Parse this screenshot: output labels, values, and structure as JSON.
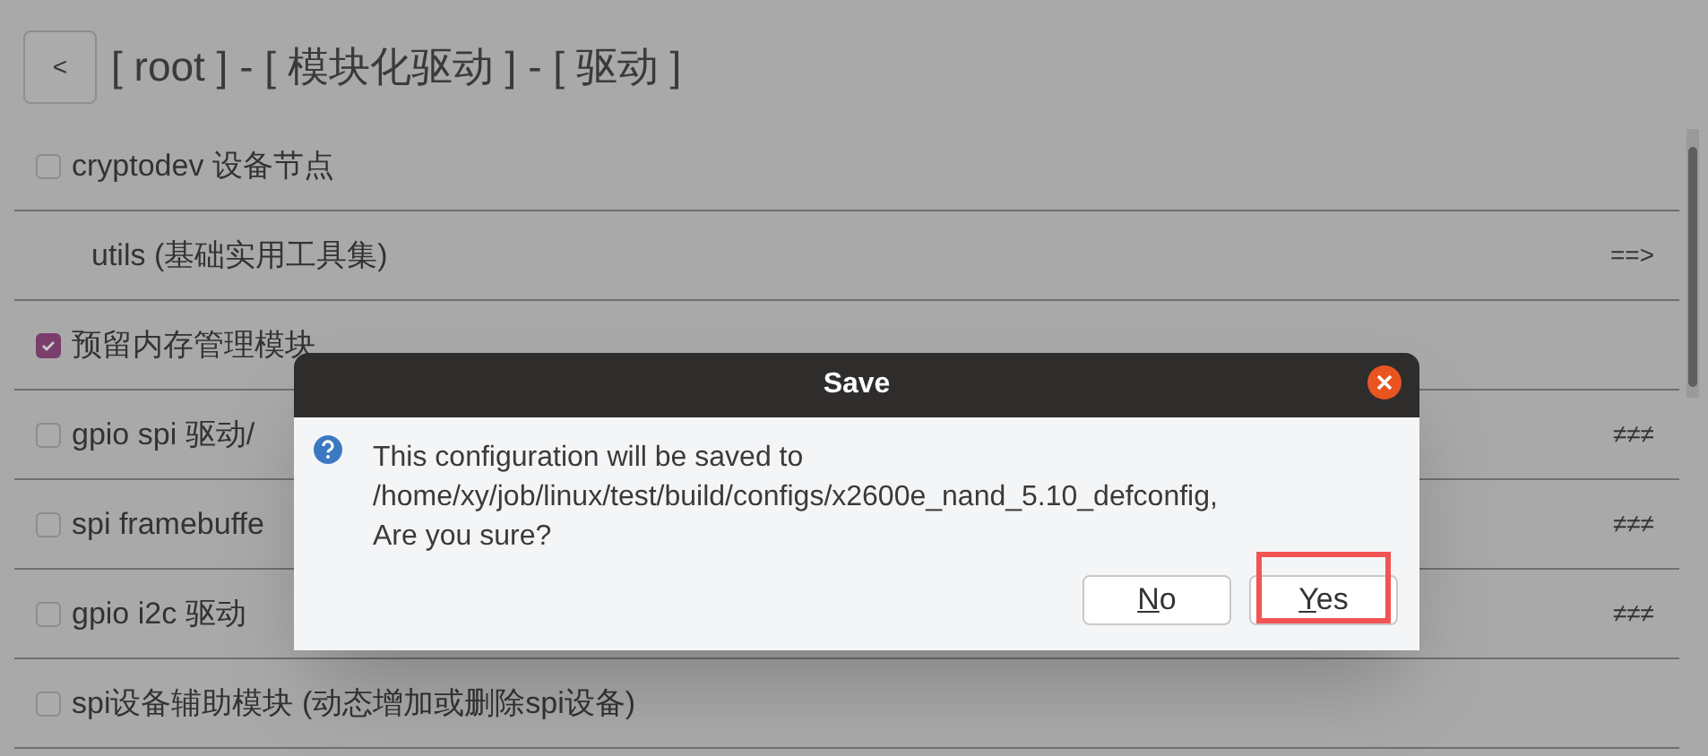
{
  "header": {
    "back_button": "<",
    "title": "[ root ] - [ 模块化驱动 ] - [ 驱动 ]"
  },
  "rows": [
    {
      "kind": "checkbox",
      "label": "cryptodev 设备节点",
      "checked": false
    },
    {
      "kind": "submenu",
      "label": "utils (基础实用工具集)",
      "marker": "==>"
    },
    {
      "kind": "checkbox",
      "label": "预留内存管理模块",
      "checked": true
    },
    {
      "kind": "checkbox",
      "label": "gpio spi 驱动/",
      "checked": false,
      "marker": "≠≠≠"
    },
    {
      "kind": "checkbox",
      "label": "spi framebuffe",
      "checked": false,
      "marker": "≠≠≠"
    },
    {
      "kind": "checkbox",
      "label": "gpio i2c 驱动",
      "checked": false,
      "marker": "≠≠≠"
    },
    {
      "kind": "checkbox",
      "label": "spi设备辅助模块 (动态增加或删除spi设备)",
      "checked": false
    }
  ],
  "dialog": {
    "title": "Save",
    "message": [
      "This configuration will be saved to",
      "/home/xy/job/linux/test/build/configs/x2600e_nand_5.10_defconfig,",
      "Are you sure?"
    ],
    "buttons": [
      {
        "label": "No",
        "highlighted": false
      },
      {
        "label": "Yes",
        "highlighted": true
      }
    ]
  }
}
